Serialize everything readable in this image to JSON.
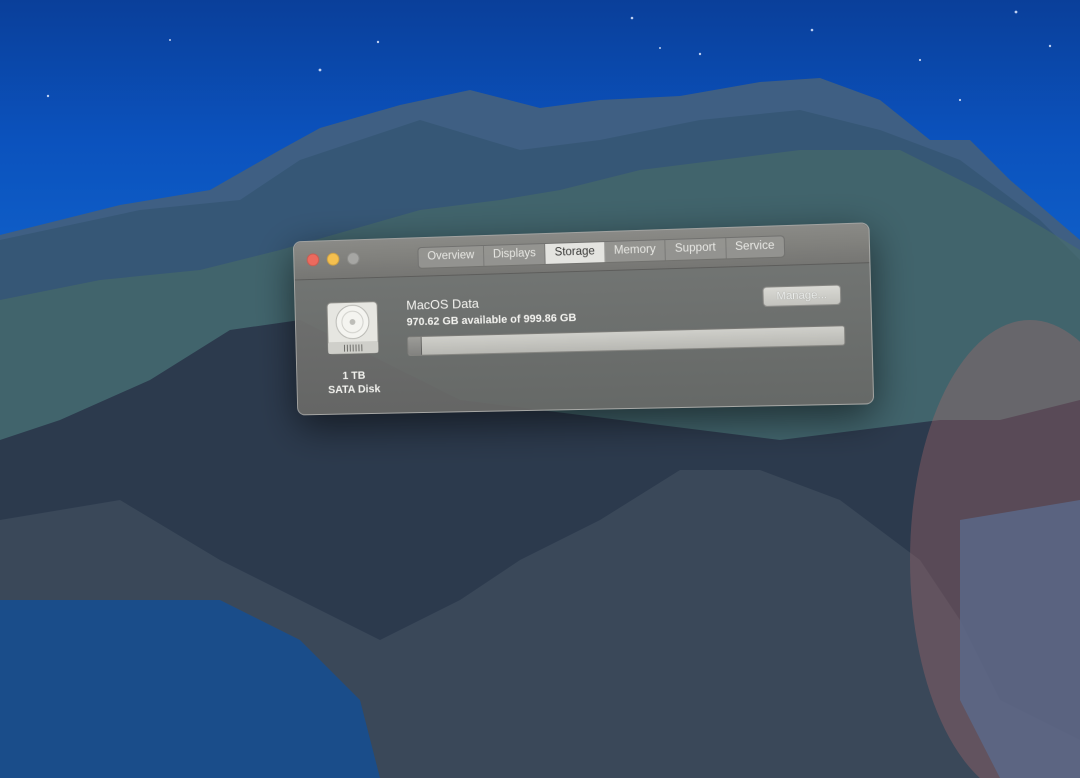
{
  "window": {
    "tabs": [
      {
        "label": "Overview",
        "active": false
      },
      {
        "label": "Displays",
        "active": false
      },
      {
        "label": "Storage",
        "active": true
      },
      {
        "label": "Memory",
        "active": false
      },
      {
        "label": "Support",
        "active": false
      },
      {
        "label": "Service",
        "active": false
      }
    ]
  },
  "storage": {
    "disk_icon": "hard-drive-icon",
    "disk_size": "1 TB",
    "disk_type": "SATA Disk",
    "volume_name": "MacOS Data",
    "available_text": "970.62 GB available of 999.86 GB",
    "manage_label": "Manage...",
    "used_fraction": 0.029
  },
  "colors": {
    "close": "#ec6a5e",
    "minimize": "#f4bf4f",
    "zoom_disabled": "#a6a6a3"
  }
}
